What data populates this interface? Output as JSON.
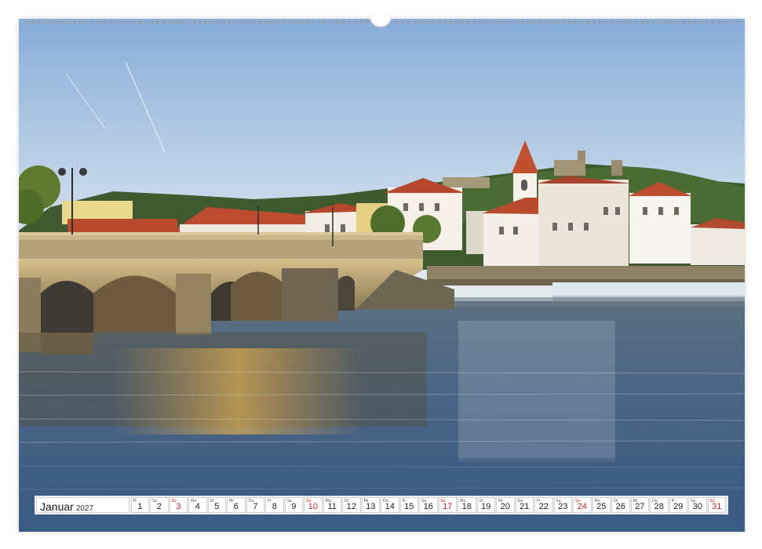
{
  "calendar": {
    "month": "Januar",
    "year": "2027",
    "days": [
      {
        "wd": "Fr",
        "num": "1",
        "sunday": false
      },
      {
        "wd": "Sa",
        "num": "2",
        "sunday": false
      },
      {
        "wd": "So",
        "num": "3",
        "sunday": true
      },
      {
        "wd": "Mo",
        "num": "4",
        "sunday": false
      },
      {
        "wd": "Di",
        "num": "5",
        "sunday": false
      },
      {
        "wd": "Mi",
        "num": "6",
        "sunday": false
      },
      {
        "wd": "Do",
        "num": "7",
        "sunday": false
      },
      {
        "wd": "Fr",
        "num": "8",
        "sunday": false
      },
      {
        "wd": "Sa",
        "num": "9",
        "sunday": false
      },
      {
        "wd": "So",
        "num": "10",
        "sunday": true
      },
      {
        "wd": "Mo",
        "num": "11",
        "sunday": false
      },
      {
        "wd": "Di",
        "num": "12",
        "sunday": false
      },
      {
        "wd": "Mi",
        "num": "13",
        "sunday": false
      },
      {
        "wd": "Do",
        "num": "14",
        "sunday": false
      },
      {
        "wd": "Fr",
        "num": "15",
        "sunday": false
      },
      {
        "wd": "Sa",
        "num": "16",
        "sunday": false
      },
      {
        "wd": "So",
        "num": "17",
        "sunday": true
      },
      {
        "wd": "Mo",
        "num": "18",
        "sunday": false
      },
      {
        "wd": "Di",
        "num": "19",
        "sunday": false
      },
      {
        "wd": "Mi",
        "num": "20",
        "sunday": false
      },
      {
        "wd": "Do",
        "num": "21",
        "sunday": false
      },
      {
        "wd": "Fr",
        "num": "22",
        "sunday": false
      },
      {
        "wd": "Sa",
        "num": "23",
        "sunday": false
      },
      {
        "wd": "So",
        "num": "24",
        "sunday": true
      },
      {
        "wd": "Mo",
        "num": "25",
        "sunday": false
      },
      {
        "wd": "Di",
        "num": "26",
        "sunday": false
      },
      {
        "wd": "Mi",
        "num": "27",
        "sunday": false
      },
      {
        "wd": "Do",
        "num": "28",
        "sunday": false
      },
      {
        "wd": "Fr",
        "num": "29",
        "sunday": false
      },
      {
        "wd": "Sa",
        "num": "30",
        "sunday": false
      },
      {
        "wd": "So",
        "num": "31",
        "sunday": true
      }
    ]
  },
  "colors": {
    "sunday_red": "#d01d1d",
    "sky_top": "#8fb3dc",
    "water": "#3f5a7a",
    "roof_terracotta": "#b84a2e",
    "bridge_stone": "#b8a57d"
  }
}
